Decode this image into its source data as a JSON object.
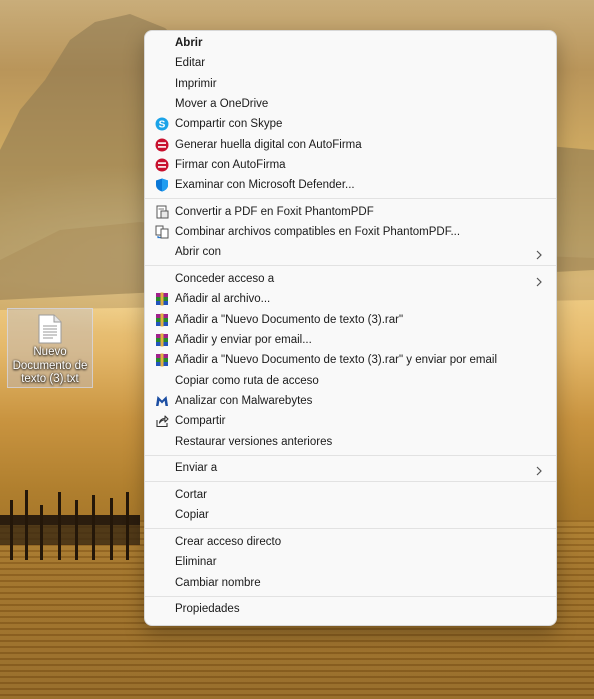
{
  "desktop": {
    "file_icon": {
      "label": "Nuevo\nDocumento de\ntexto (3).txt",
      "icon": "text-file-icon"
    }
  },
  "context_menu": {
    "groups": [
      [
        {
          "label": "Abrir",
          "bold": true
        },
        {
          "label": "Editar"
        },
        {
          "label": "Imprimir"
        },
        {
          "label": "Mover a OneDrive"
        },
        {
          "label": "Compartir con Skype",
          "icon": "skype-icon"
        },
        {
          "label": "Generar huella digital con AutoFirma",
          "icon": "autofirma-icon"
        },
        {
          "label": "Firmar con AutoFirma",
          "icon": "autofirma-icon"
        },
        {
          "label": "Examinar con Microsoft Defender...",
          "icon": "defender-shield-icon"
        }
      ],
      [
        {
          "label": "Convertir a PDF en Foxit PhantomPDF",
          "icon": "foxit-convert-icon"
        },
        {
          "label": "Combinar archivos compatibles en Foxit PhantomPDF...",
          "icon": "foxit-combine-icon"
        },
        {
          "label": "Abrir con",
          "submenu": true
        }
      ],
      [
        {
          "label": "Conceder acceso a",
          "submenu": true
        },
        {
          "label": "Añadir al archivo...",
          "icon": "winrar-icon"
        },
        {
          "label": "Añadir a \"Nuevo Documento de texto (3).rar\"",
          "icon": "winrar-icon"
        },
        {
          "label": "Añadir y enviar por email...",
          "icon": "winrar-icon"
        },
        {
          "label": "Añadir a \"Nuevo Documento de texto (3).rar\" y enviar por email",
          "icon": "winrar-icon"
        },
        {
          "label": "Copiar como ruta de acceso"
        },
        {
          "label": "Analizar con Malwarebytes",
          "icon": "malwarebytes-icon"
        },
        {
          "label": "Compartir",
          "icon": "share-icon"
        },
        {
          "label": "Restaurar versiones anteriores"
        }
      ],
      [
        {
          "label": "Enviar a",
          "submenu": true
        }
      ],
      [
        {
          "label": "Cortar"
        },
        {
          "label": "Copiar"
        }
      ],
      [
        {
          "label": "Crear acceso directo"
        },
        {
          "label": "Eliminar"
        },
        {
          "label": "Cambiar nombre"
        }
      ],
      [
        {
          "label": "Propiedades"
        }
      ]
    ]
  },
  "colors": {
    "menu_bg": "#f9f9f9",
    "skype": "#1ba3e8",
    "autofirma": "#c8102e",
    "defender": "#0a78d7",
    "malwarebytes": "#1d4fa3"
  }
}
